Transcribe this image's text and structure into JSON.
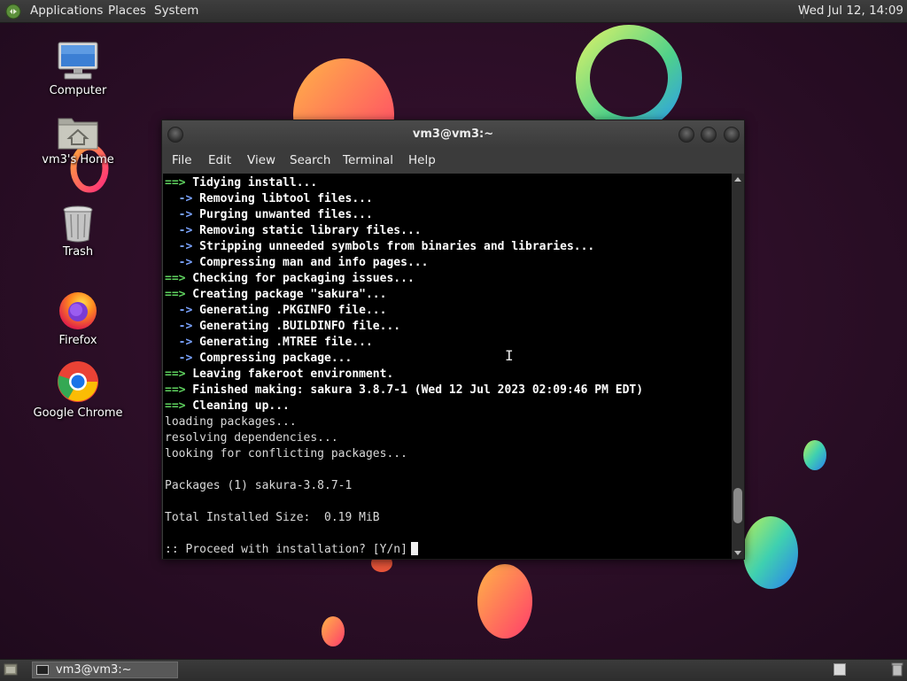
{
  "top_panel": {
    "menus": [
      "Applications",
      "Places",
      "System"
    ],
    "clock": "Wed Jul 12, 14:09",
    "logo_icon": "mate-logo-icon"
  },
  "desktop_icons": [
    {
      "label": "Computer",
      "icon": "computer-icon"
    },
    {
      "label": "vm3's Home",
      "icon": "home-folder-icon"
    },
    {
      "label": "Trash",
      "icon": "trash-icon"
    },
    {
      "label": "Firefox",
      "icon": "firefox-icon"
    },
    {
      "label": "Google Chrome",
      "icon": "chrome-icon"
    }
  ],
  "terminal": {
    "title": "vm3@vm3:~",
    "menu": [
      "File",
      "Edit",
      "View",
      "Search",
      "Terminal",
      "Help"
    ],
    "lines": [
      {
        "prefix": "==>",
        "kind": "g",
        "text": " Tidying install..."
      },
      {
        "prefix": "  ->",
        "kind": "b",
        "text": " Removing libtool files..."
      },
      {
        "prefix": "  ->",
        "kind": "b",
        "text": " Purging unwanted files..."
      },
      {
        "prefix": "  ->",
        "kind": "b",
        "text": " Removing static library files..."
      },
      {
        "prefix": "  ->",
        "kind": "b",
        "text": " Stripping unneeded symbols from binaries and libraries..."
      },
      {
        "prefix": "  ->",
        "kind": "b",
        "text": " Compressing man and info pages..."
      },
      {
        "prefix": "==>",
        "kind": "g",
        "text": " Checking for packaging issues..."
      },
      {
        "prefix": "==>",
        "kind": "g",
        "text": " Creating package \"sakura\"..."
      },
      {
        "prefix": "  ->",
        "kind": "b",
        "text": " Generating .PKGINFO file..."
      },
      {
        "prefix": "  ->",
        "kind": "b",
        "text": " Generating .BUILDINFO file..."
      },
      {
        "prefix": "  ->",
        "kind": "b",
        "text": " Generating .MTREE file..."
      },
      {
        "prefix": "  ->",
        "kind": "b",
        "text": " Compressing package..."
      },
      {
        "prefix": "==>",
        "kind": "g",
        "text": " Leaving fakeroot environment."
      },
      {
        "prefix": "==>",
        "kind": "g",
        "text": " Finished making: sakura 3.8.7-1 (Wed 12 Jul 2023 02:09:46 PM EDT)"
      },
      {
        "prefix": "==>",
        "kind": "g",
        "text": " Cleaning up..."
      },
      {
        "prefix": "",
        "kind": "plain",
        "text": "loading packages..."
      },
      {
        "prefix": "",
        "kind": "plain",
        "text": "resolving dependencies..."
      },
      {
        "prefix": "",
        "kind": "plain",
        "text": "looking for conflicting packages..."
      },
      {
        "prefix": "",
        "kind": "plain",
        "text": ""
      },
      {
        "prefix": "",
        "kind": "plain",
        "text": "Packages (1) sakura-3.8.7-1"
      },
      {
        "prefix": "",
        "kind": "plain",
        "text": ""
      },
      {
        "prefix": "",
        "kind": "plain",
        "text": "Total Installed Size:  0.19 MiB"
      },
      {
        "prefix": "",
        "kind": "plain",
        "text": ""
      },
      {
        "prefix": "",
        "kind": "prompt",
        "text": ":: Proceed with installation? [Y/n]"
      }
    ],
    "scroll_position": 0.93
  },
  "bottom_panel": {
    "task_label": "vm3@vm3:~",
    "task_icon": "terminal-icon"
  },
  "colors": {
    "wallpaper_bg": "#2a0d27",
    "prompt_green": "#5fd35f",
    "arrow_blue": "#7aa3ff"
  }
}
